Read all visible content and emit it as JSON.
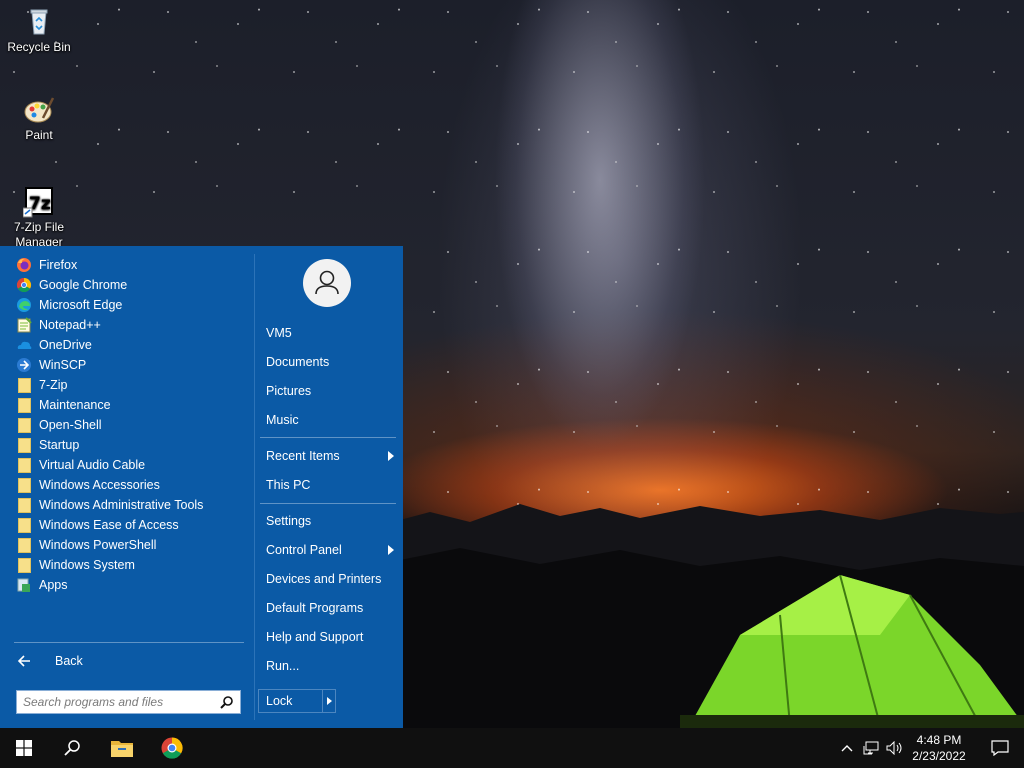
{
  "desktop": {
    "icons": [
      {
        "label": "Recycle Bin",
        "icon": "recycle-bin-icon"
      },
      {
        "label": "Paint",
        "icon": "paint-icon"
      },
      {
        "label": "7-Zip File Manager",
        "icon": "7zip-icon"
      }
    ]
  },
  "start_menu": {
    "programs": [
      {
        "label": "Firefox",
        "icon": "firefox-icon"
      },
      {
        "label": "Google Chrome",
        "icon": "chrome-icon"
      },
      {
        "label": "Microsoft Edge",
        "icon": "edge-icon"
      },
      {
        "label": "Notepad++",
        "icon": "notepadpp-icon"
      },
      {
        "label": "OneDrive",
        "icon": "onedrive-icon"
      },
      {
        "label": "WinSCP",
        "icon": "winscp-icon"
      },
      {
        "label": "7-Zip",
        "icon": "folder-icon"
      },
      {
        "label": "Maintenance",
        "icon": "folder-icon"
      },
      {
        "label": "Open-Shell",
        "icon": "folder-icon"
      },
      {
        "label": "Startup",
        "icon": "folder-icon"
      },
      {
        "label": "Virtual Audio Cable",
        "icon": "folder-icon"
      },
      {
        "label": "Windows Accessories",
        "icon": "folder-icon"
      },
      {
        "label": "Windows Administrative Tools",
        "icon": "folder-icon"
      },
      {
        "label": "Windows Ease of Access",
        "icon": "folder-icon"
      },
      {
        "label": "Windows PowerShell",
        "icon": "folder-icon"
      },
      {
        "label": "Windows System",
        "icon": "folder-icon"
      },
      {
        "label": "Apps",
        "icon": "apps-icon"
      }
    ],
    "back_label": "Back",
    "search_placeholder": "Search programs and files",
    "right_items": [
      {
        "label": "VM5"
      },
      {
        "label": "Documents"
      },
      {
        "label": "Pictures"
      },
      {
        "label": "Music"
      },
      {
        "label": "Recent Items",
        "submenu": true
      },
      {
        "label": "This PC"
      },
      {
        "label": "Settings"
      },
      {
        "label": "Control Panel",
        "submenu": true
      },
      {
        "label": "Devices and Printers"
      },
      {
        "label": "Default Programs"
      },
      {
        "label": "Help and Support"
      },
      {
        "label": "Run..."
      }
    ],
    "lock_label": "Lock"
  },
  "taskbar": {
    "buttons": [
      "windows-start-icon",
      "search-icon",
      "file-explorer-icon",
      "chrome-icon"
    ],
    "tray_icons": [
      "chevron-up-icon",
      "network-icon",
      "volume-icon"
    ],
    "time": "4:48 PM",
    "date": "2/23/2022",
    "notification_icon": "action-center-icon"
  },
  "colors": {
    "start_menu_bg": "#0b5aa6",
    "taskbar_bg": "#101010",
    "folder": "#f7e08a"
  }
}
